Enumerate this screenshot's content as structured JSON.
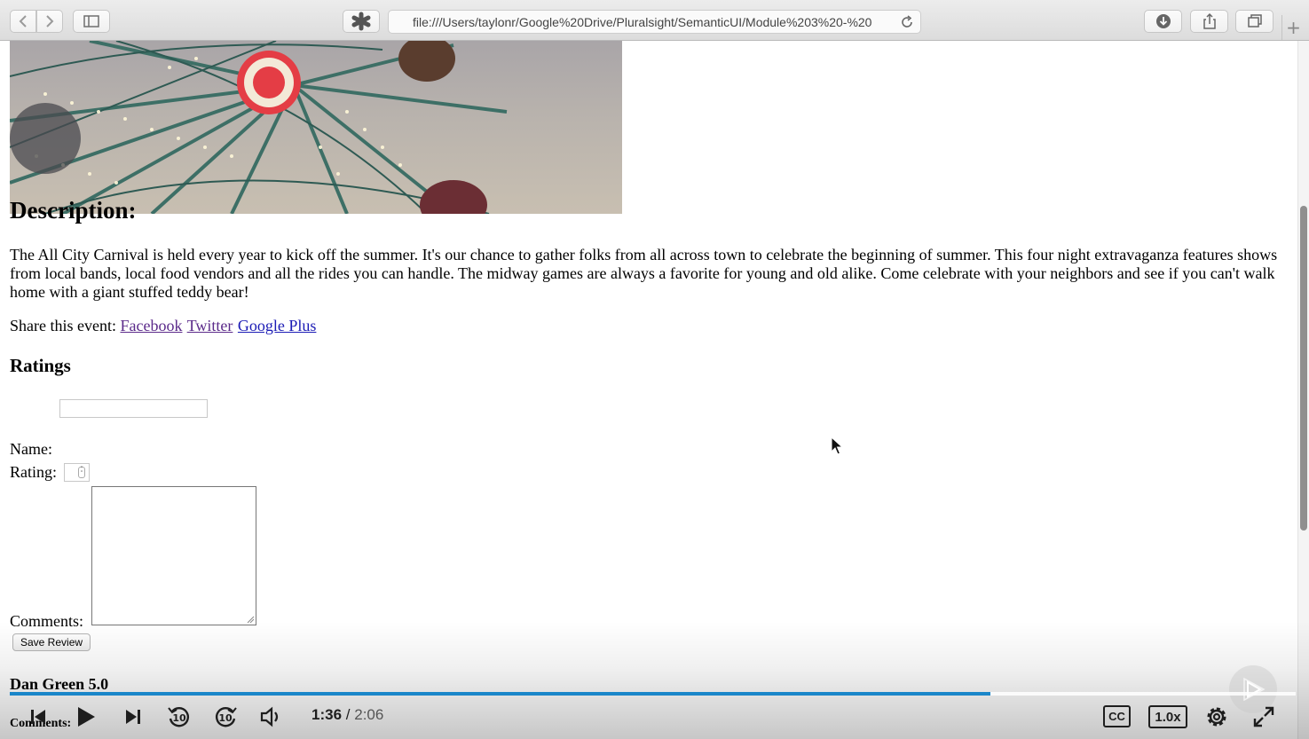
{
  "browser": {
    "url": "file:///Users/taylonr/Google%20Drive/Pluralsight/SemanticUI/Module%203%20-%20",
    "new_tab_label": "+"
  },
  "page": {
    "description_heading": "Description:",
    "description_text": "The All City Carnival is held every year to kick off the summer. It's our chance to gather folks from all across town to celebrate the beginning of summer. This four night extravaganza features shows from local bands, local food vendors and all the rides you can handle. The midway games are always a favorite for young and old alike. Come celebrate with your neighbors and see if you can't walk home with a giant stuffed teddy bear!",
    "share": {
      "label": "Share this event:",
      "links": [
        "Facebook",
        "Twitter",
        "Google Plus"
      ]
    },
    "ratings_heading": "Ratings",
    "form": {
      "name_label": "Name:",
      "name_value": "",
      "rating_label": "Rating:",
      "rating_value": "",
      "comments_label": "Comments:",
      "comments_value": "",
      "save_label": "Save Review"
    },
    "review": {
      "title": "Dan Green 5.0",
      "comments_label": "Comments:"
    }
  },
  "player": {
    "current_time": "1:36",
    "separator": "/",
    "total_time": "2:06",
    "progress_fraction": 0.7623,
    "cc_label": "CC",
    "speed_label": "1.0x",
    "accent_color": "#1a86c9"
  },
  "icons": [
    "back-icon",
    "forward-icon",
    "sidebar-icon",
    "extension-icon",
    "reload-icon",
    "download-icon",
    "share-icon",
    "tabs-icon",
    "skip-back-icon",
    "play-icon",
    "skip-forward-icon",
    "rewind-10-icon",
    "forward-10-icon",
    "volume-icon",
    "settings-icon",
    "fullscreen-icon",
    "pluralsight-logo-icon",
    "cursor-icon"
  ]
}
